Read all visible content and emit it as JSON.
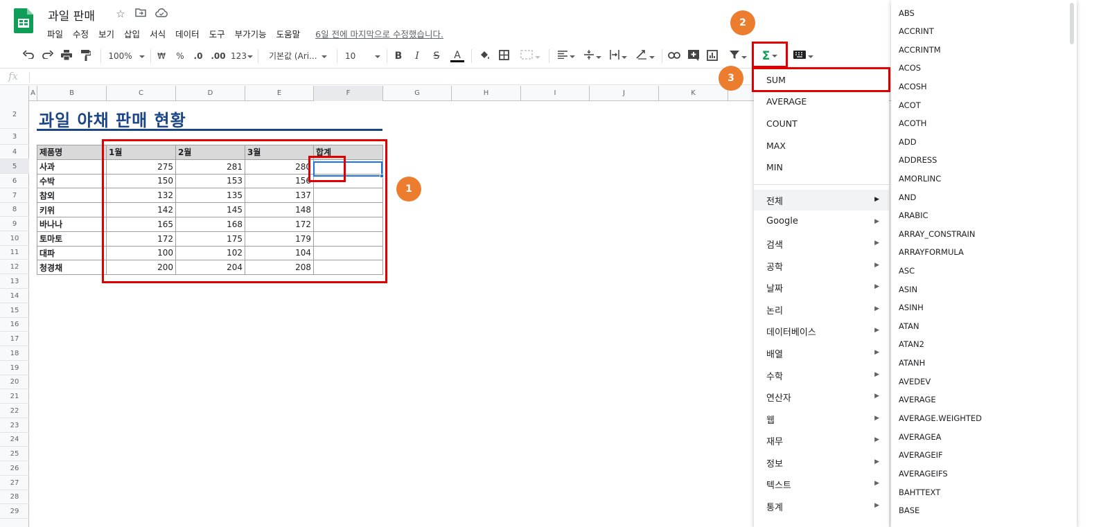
{
  "header": {
    "title": "과일 판매",
    "menu": [
      "파일",
      "수정",
      "보기",
      "삽입",
      "서식",
      "데이터",
      "도구",
      "부가기능",
      "도움말"
    ],
    "last_edit": "6일 전에 마지막으로 수정했습니다."
  },
  "toolbar": {
    "zoom": "100%",
    "currency": "₩",
    "percent": "%",
    "decimal_decrease": ".0",
    "decimal_increase": ".00",
    "format_more": "123",
    "font": "기본값 (Ari...",
    "font_size": "10",
    "bold": "B",
    "italic": "I",
    "strikethrough": "S",
    "text_color": "A",
    "sigma": "Σ"
  },
  "formula_bar": {
    "fx": "fx",
    "value": ""
  },
  "columns": [
    "A",
    "B",
    "C",
    "D",
    "E",
    "F",
    "G",
    "H",
    "I",
    "J",
    "K"
  ],
  "rows": [
    "2",
    "3",
    "4",
    "5",
    "6",
    "7",
    "8",
    "9",
    "10",
    "11",
    "12",
    "13",
    "14",
    "15",
    "16",
    "17",
    "18",
    "19",
    "20",
    "21",
    "22",
    "23",
    "24",
    "25",
    "26",
    "27",
    "28",
    "29"
  ],
  "sheet": {
    "title": "과일 야채 판매 현황",
    "table": {
      "headers": [
        "제품명",
        "1월",
        "2월",
        "3월",
        "합계"
      ],
      "rows": [
        [
          "사과",
          "275",
          "281",
          "280",
          ""
        ],
        [
          "수박",
          "150",
          "153",
          "156",
          ""
        ],
        [
          "참외",
          "132",
          "135",
          "137",
          ""
        ],
        [
          "키위",
          "142",
          "145",
          "148",
          ""
        ],
        [
          "바나나",
          "165",
          "168",
          "172",
          ""
        ],
        [
          "토마토",
          "172",
          "175",
          "179",
          ""
        ],
        [
          "대파",
          "100",
          "102",
          "104",
          ""
        ],
        [
          "청경채",
          "200",
          "204",
          "208",
          ""
        ]
      ]
    }
  },
  "annotations": {
    "badge1": "1",
    "badge2": "2",
    "badge3": "3"
  },
  "sum_menu": {
    "top_functions": [
      "SUM",
      "AVERAGE",
      "COUNT",
      "MAX",
      "MIN"
    ],
    "categories": [
      "전체",
      "Google",
      "검색",
      "공학",
      "날짜",
      "논리",
      "데이터베이스",
      "배열",
      "수학",
      "연산자",
      "웹",
      "재무",
      "정보",
      "텍스트",
      "통계"
    ]
  },
  "function_list": [
    "ABS",
    "ACCRINT",
    "ACCRINTM",
    "ACOS",
    "ACOSH",
    "ACOT",
    "ACOTH",
    "ADD",
    "ADDRESS",
    "AMORLINC",
    "AND",
    "ARABIC",
    "ARRAY_CONSTRAIN",
    "ARRAYFORMULA",
    "ASC",
    "ASIN",
    "ASINH",
    "ATAN",
    "ATAN2",
    "ATANH",
    "AVEDEV",
    "AVERAGE",
    "AVERAGE.WEIGHTED",
    "AVERAGEA",
    "AVERAGEIF",
    "AVERAGEIFS",
    "BAHTTEXT",
    "BASE"
  ],
  "colors": {
    "accent": "#1a73e8",
    "title_blue": "#1c4587",
    "annotation_red": "#e00000",
    "badge_orange": "#ec7c2e",
    "sheets_green": "#0f9d58"
  }
}
